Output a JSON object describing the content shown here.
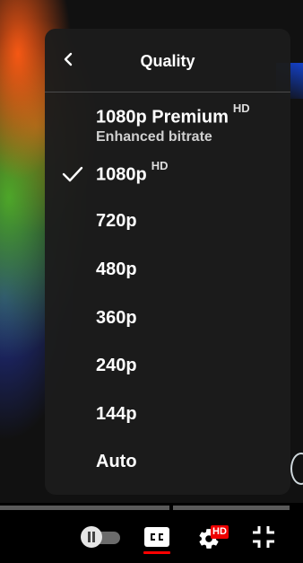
{
  "menu": {
    "title": "Quality",
    "items": [
      {
        "label": "1080p Premium",
        "badge": "HD",
        "sublabel": "Enhanced bitrate",
        "selected": false
      },
      {
        "label": "1080p",
        "badge": "HD",
        "selected": true
      },
      {
        "label": "720p",
        "selected": false
      },
      {
        "label": "480p",
        "selected": false
      },
      {
        "label": "360p",
        "selected": false
      },
      {
        "label": "240p",
        "selected": false
      },
      {
        "label": "144p",
        "selected": false
      },
      {
        "label": "Auto",
        "selected": false
      }
    ]
  },
  "controls": {
    "settings_badge": "HD",
    "captions_enabled": true,
    "autoplay_state": "paused",
    "icons": [
      "back-chevron-icon",
      "checkmark-icon",
      "pause-icon",
      "cc-icon",
      "gear-icon",
      "exit-fullscreen-icon"
    ]
  },
  "colors": {
    "menu_bg": "#1c1c1c",
    "accent_red": "#ff0000",
    "text": "#ffffff"
  }
}
